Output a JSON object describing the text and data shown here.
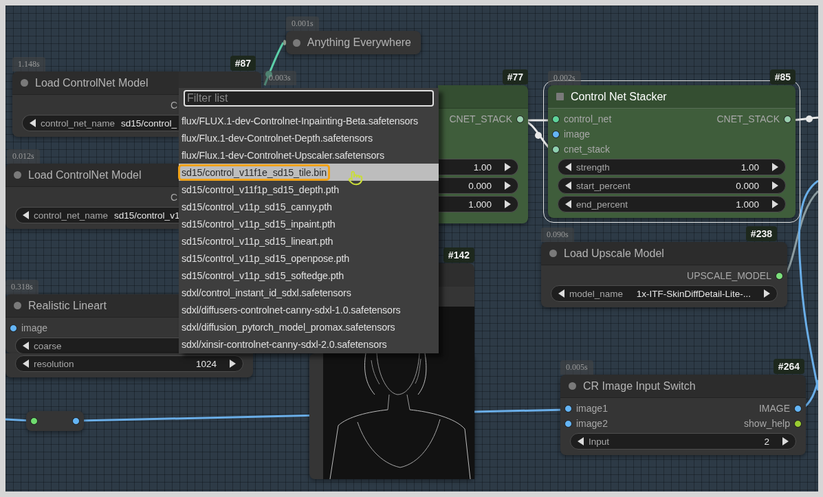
{
  "canvas": {
    "nodes": [
      {
        "kind": "collapsed",
        "title": "Anything Everywhere",
        "timing": "0.001s"
      },
      {
        "kind": "node",
        "title": "Load ControlNet Model",
        "timing": "1.148s",
        "badge": "#87",
        "color": "#353535",
        "selected": false,
        "outputs": [
          {
            "label": "C"
          }
        ],
        "widgets": [
          {
            "label": "control_net_name",
            "value": "sd15/control_"
          }
        ]
      },
      {
        "kind": "node",
        "timing": "0.003s",
        "badge": "#77",
        "color": "#3f5d3b",
        "selected": false,
        "outputs": [
          {
            "label": "CNET_STACK",
            "color": "#9ad0b0"
          }
        ],
        "widgets": [
          {
            "value": "1.00"
          },
          {
            "value": "0.000"
          },
          {
            "value": "1.000"
          }
        ]
      },
      {
        "kind": "node",
        "title": "Control Net Stacker",
        "timing": "0.002s",
        "badge": "#85",
        "color": "#3f5d3b",
        "selected": true,
        "inputs": [
          {
            "label": "control_net",
            "color": "#5fd39a"
          },
          {
            "label": "image",
            "color": "#64b5f6"
          },
          {
            "label": "cnet_stack",
            "color": "#8fd0b0"
          }
        ],
        "outputs": [
          {
            "label": "CNET_STACK",
            "color": "#9ad0b0"
          }
        ],
        "widgets": [
          {
            "label": "strength",
            "value": "1.00"
          },
          {
            "label": "start_percent",
            "value": "0.000"
          },
          {
            "label": "end_percent",
            "value": "1.000"
          }
        ]
      },
      {
        "kind": "node",
        "title": "Load ControlNet Model",
        "timing": "0.012s",
        "color": "#353535",
        "selected": false,
        "outputs": [
          {
            "label": "C"
          }
        ],
        "widgets": [
          {
            "label": "control_net_name",
            "value": "sd15/control_v1"
          }
        ]
      },
      {
        "kind": "node",
        "title": "Load Upscale Model",
        "timing": "0.090s",
        "badge": "#238",
        "color": "#353535",
        "selected": false,
        "outputs": [
          {
            "label": "UPSCALE_MODEL",
            "color": "#7ce07c"
          }
        ],
        "widgets": [
          {
            "label": "model_name",
            "value": "1x-ITF-SkinDiffDetail-Lite-..."
          }
        ]
      },
      {
        "kind": "node",
        "title": "Realistic Lineart",
        "timing": "0.318s",
        "color": "#353535",
        "selected": false,
        "inputs": [
          {
            "label": "image",
            "color": "#64b5f6"
          }
        ],
        "widgets": [
          {
            "label": "coarse"
          },
          {
            "label": "resolution",
            "value": "1024"
          }
        ]
      },
      {
        "kind": "preview",
        "badge": "#142"
      },
      {
        "kind": "node",
        "title": "CR Image Input Switch",
        "timing": "0.005s",
        "badge": "#264",
        "color": "#353535",
        "selected": false,
        "inputs": [
          {
            "label": "image1",
            "color": "#64b5f6"
          },
          {
            "label": "image2",
            "color": "#64b5f6"
          }
        ],
        "outputs": [
          {
            "label": "IMAGE",
            "color": "#64b5f6"
          },
          {
            "label": "show_help",
            "color": "#9acd32"
          }
        ],
        "widgets": [
          {
            "label": "Input",
            "value": "2"
          }
        ]
      },
      {
        "kind": "reroute",
        "inputs": [
          {
            "color": "#6fdc6f"
          }
        ],
        "outputs": [
          {
            "color": "#64b5f6"
          }
        ]
      }
    ],
    "dropdown": {
      "placeholder": "Filter list",
      "items": [
        {
          "label": "flux/FLUX.1-dev-Controlnet-Inpainting-Beta.safetensors",
          "selected": false
        },
        {
          "label": "flux/Flux.1-dev-Controlnet-Depth.safetensors",
          "selected": false
        },
        {
          "label": "flux/Flux.1-dev-Controlnet-Upscaler.safetensors",
          "selected": false
        },
        {
          "label": "sd15/control_v11f1e_sd15_tile.bin",
          "selected": true
        },
        {
          "label": "sd15/control_v11f1p_sd15_depth.pth",
          "selected": false
        },
        {
          "label": "sd15/control_v11p_sd15_canny.pth",
          "selected": false
        },
        {
          "label": "sd15/control_v11p_sd15_inpaint.pth",
          "selected": false
        },
        {
          "label": "sd15/control_v11p_sd15_lineart.pth",
          "selected": false
        },
        {
          "label": "sd15/control_v11p_sd15_openpose.pth",
          "selected": false
        },
        {
          "label": "sd15/control_v11p_sd15_softedge.pth",
          "selected": false
        },
        {
          "label": "sdxl/control_instant_id_sdxl.safetensors",
          "selected": false
        },
        {
          "label": "sdxl/diffusers-controlnet-canny-sdxl-1.0.safetensors",
          "selected": false
        },
        {
          "label": "sdxl/diffusion_pytorch_model_promax.safetensors",
          "selected": false
        },
        {
          "label": "sdxl/xinsir-controlnet-canny-sdxl-2.0.safetensors",
          "selected": false
        }
      ]
    }
  }
}
